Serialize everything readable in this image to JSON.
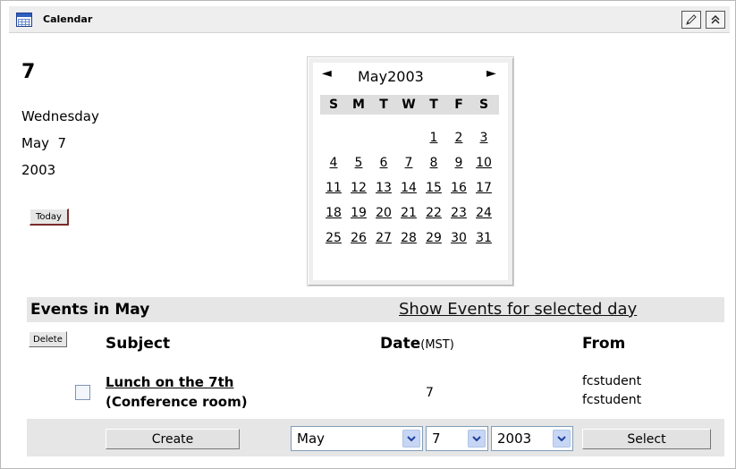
{
  "window": {
    "title": "Calendar"
  },
  "icons": {
    "calendar": "calendar-icon",
    "edit": "pencil-icon",
    "collapse": "collapse-up-icon"
  },
  "day": {
    "number": "7",
    "weekday": "Wednesday",
    "month_day": "May  7",
    "year": "2003",
    "today_label": "Today"
  },
  "minical": {
    "prev": "◄",
    "next": "►",
    "month_year": "May2003",
    "dow": [
      "S",
      "M",
      "T",
      "W",
      "T",
      "F",
      "S"
    ],
    "weeks": [
      [
        "",
        "",
        "",
        "",
        "1",
        "2",
        "3"
      ],
      [
        "4",
        "5",
        "6",
        "7",
        "8",
        "9",
        "10"
      ],
      [
        "11",
        "12",
        "13",
        "14",
        "15",
        "16",
        "17"
      ],
      [
        "18",
        "19",
        "20",
        "21",
        "22",
        "23",
        "24"
      ],
      [
        "25",
        "26",
        "27",
        "28",
        "29",
        "30",
        "31"
      ]
    ]
  },
  "events": {
    "title": "Events in May",
    "show_link": "Show Events for selected day",
    "delete_label": "Delete",
    "columns": {
      "subject": "Subject",
      "date": "Date",
      "date_tz": "(MST)",
      "from": "From"
    },
    "rows": [
      {
        "subject_line1": "Lunch on the 7th",
        "subject_line2": "(Conference room)",
        "date": "7",
        "from_line1": "fcstudent",
        "from_line2": "fcstudent"
      }
    ]
  },
  "footer": {
    "create_label": "Create",
    "month_value": "May",
    "day_value": "7",
    "year_value": "2003",
    "select_label": "Select"
  },
  "colors": {
    "header_bg": "#eeeeee",
    "section_bg": "#e6e6e6",
    "button_shadow": "#7a2a2a",
    "select_arrow": "#c6d6f4"
  }
}
